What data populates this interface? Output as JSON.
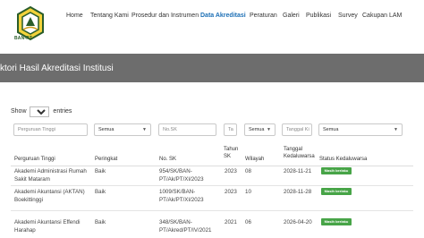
{
  "brand": {
    "logo_text": "BAN-PT"
  },
  "nav": {
    "items": [
      "Home",
      "Tentang Kami",
      "Prosedur dan Instrumen",
      "Data Akreditasi",
      "Peraturan",
      "Galeri",
      "Publikasi",
      "Survey",
      "Cakupan LAM"
    ],
    "active": "Data Akreditasi"
  },
  "banner": {
    "title": "ktori Hasil Akreditasi Institusi"
  },
  "length": {
    "prefix": "Show",
    "value": "10",
    "suffix": "entries"
  },
  "filters": {
    "pt": "Perguruan Tinggi",
    "peringkat": "Semua",
    "sk": "No.SK",
    "tahun": "Ta",
    "wilayah": "Semua",
    "tanggal": "Tanggal Ki",
    "status": "Semua"
  },
  "table": {
    "headers": {
      "pt": "Perguruan Tinggi",
      "peringkat": "Peringkat",
      "sk": "No. SK",
      "tahun": "Tahun SK",
      "wilayah": "Wilayah",
      "tanggal": "Tanggal Kedaluwarsa",
      "status": "Status Kedaluwarsa"
    },
    "rows": [
      {
        "pt": "Akademi Administrasi Rumah Sakit Mataram",
        "peringkat": "Baik",
        "sk": "954/SK/BAN-PT/Ak/PT/XI/2023",
        "tahun": "2023",
        "wilayah": "08",
        "tanggal": "2028-11-21",
        "status": "Masih berlaku"
      },
      {
        "pt": "Akademi Akuntansi (AKTAN) Boekittinggi",
        "peringkat": "Baik",
        "sk": "1009/SK/BAN-PT/Ak/PT/XI/2023",
        "tahun": "2023",
        "wilayah": "10",
        "tanggal": "2028-11-28",
        "status": "Masih berlaku"
      },
      {
        "pt": "Akademi Akuntansi Effendi Harahap",
        "peringkat": "Baik",
        "sk": "348/SK/BAN-PT/Akred/PT/IV/2021",
        "tahun": "2021",
        "wilayah": "06",
        "tanggal": "2026-04-20",
        "status": "Masih berlaku"
      }
    ]
  },
  "colors": {
    "active_nav": "#1c6fb5",
    "banner": "#6d6d6d",
    "badge": "#47a447"
  }
}
